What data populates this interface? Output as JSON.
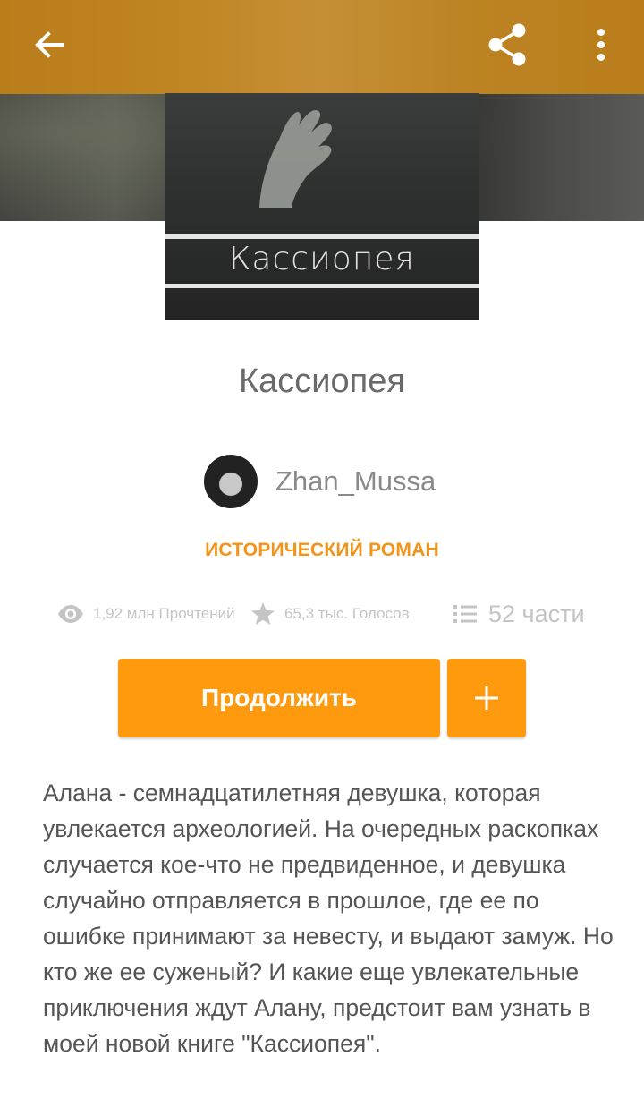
{
  "appbar": {
    "back_icon": "arrow-left-icon",
    "share_icon": "share-icon",
    "more_icon": "more-vert-icon"
  },
  "cover": {
    "title_text": "Кассиопея"
  },
  "story": {
    "title": "Кассиопея",
    "author": "Zhan_Mussa",
    "genre": "ИСТОРИЧЕСКИЙ РОМАН",
    "stats": {
      "reads": "1,92 млн Прочтений",
      "votes": "65,3 тыс. Голосов",
      "parts": "52 части"
    },
    "continue_label": "Продолжить",
    "add_label": "+",
    "description": "Алана - семнадцатилетняя девушка, которая увлекается археологией. На очередных раскопках случается кое-что не предвиденное, и девушка случайно отправляется в прошлое, где ее по ошибке принимают за невесту, и выдают замуж. Но кто же ее суженый? И какие еще увлекательные приключения ждут Алану, предстоит вам узнать в моей новой книге \"Кассиопея\"."
  },
  "colors": {
    "appbar": "#c08624",
    "accent": "#ff9a0f",
    "genre": "#f2941a"
  }
}
